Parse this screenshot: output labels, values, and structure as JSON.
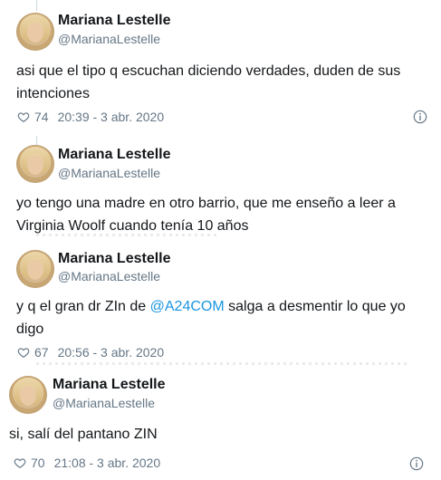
{
  "tweets": [
    {
      "name": "Mariana Lestelle",
      "handle": "@MarianaLestelle",
      "text_lines": [
        "asi que el tipo q escuchan diciendo verdades, duden de sus",
        "intenciones"
      ],
      "likes": "74",
      "time": "20:39 - 3 abr. 2020"
    },
    {
      "name": "Mariana Lestelle",
      "handle": "@MarianaLestelle",
      "text_lines": [
        "yo tengo una madre en otro barrio, que me enseño a leer a",
        "Virginia Woolf cuando tenía 10 años"
      ]
    },
    {
      "name": "Mariana Lestelle",
      "handle": "@MarianaLestelle",
      "text_pre": "y q el gran dr ZIn de ",
      "mention": "@A24COM",
      "text_post": " salga a desmentir lo que yo",
      "text_line2": "digo",
      "likes": "67",
      "time": "20:56 - 3 abr. 2020"
    },
    {
      "name": "Mariana Lestelle",
      "handle": "@MarianaLestelle",
      "text_lines": [
        "si, salí del pantano  ZIN"
      ],
      "likes": "70",
      "time": "21:08 - 3 abr. 2020"
    }
  ],
  "colors": {
    "text": "#14171a",
    "secondary": "#657786",
    "mention": "#1b95e0",
    "thread": "#cfd9de"
  },
  "icons": [
    "heart-icon",
    "info-icon"
  ]
}
